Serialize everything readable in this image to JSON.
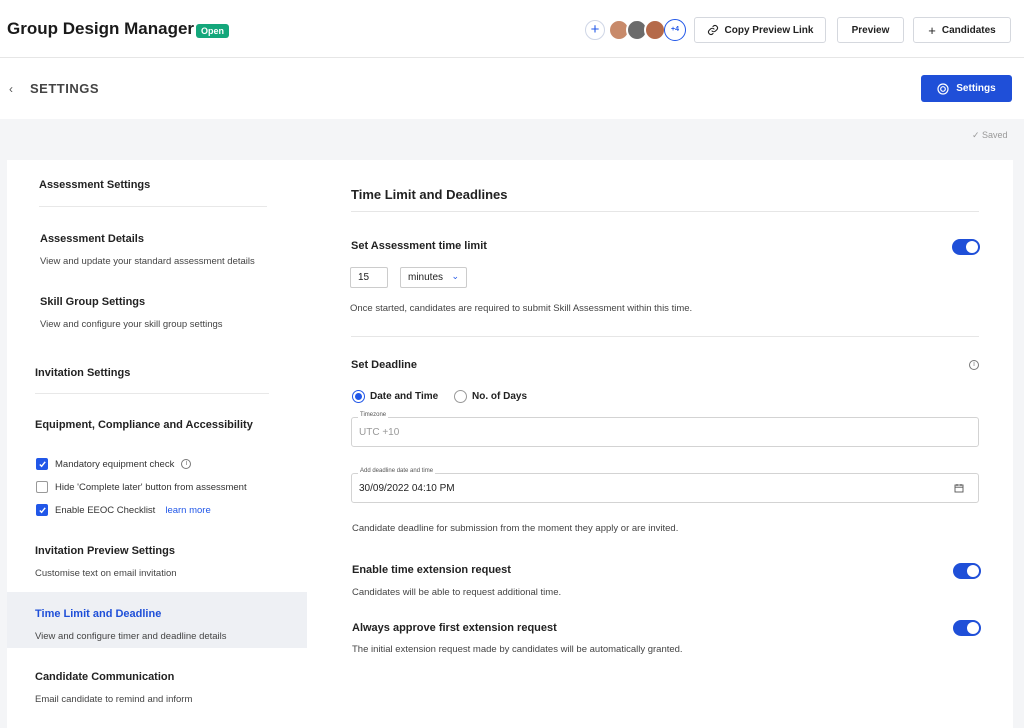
{
  "header": {
    "title": "Group Design Manager",
    "status": "Open",
    "add_collaborator": "+",
    "collaborators_more": "+4",
    "copy_preview_link": "Copy Preview Link",
    "preview": "Preview",
    "candidates": "Candidates",
    "candidates_prefix": "+"
  },
  "subheader": {
    "back": "‹",
    "title": "SETTINGS",
    "settings_button": "Settings",
    "saved": "✓ Saved"
  },
  "sidebar": {
    "assessment_settings": "Assessment Settings",
    "assessment_details": {
      "title": "Assessment Details",
      "desc": "View and update your standard assessment details"
    },
    "skill_group": {
      "title": "Skill Group Settings",
      "desc": "View and configure your skill group settings"
    },
    "invitation_settings": "Invitation Settings",
    "equipment": "Equipment, Compliance and Accessibility",
    "checkboxes": [
      {
        "label": "Mandatory equipment check",
        "checked": true
      },
      {
        "label": "Hide 'Complete later' button from assessment",
        "checked": false
      },
      {
        "label": "Enable EEOC Checklist",
        "checked": true
      }
    ],
    "learn_more": "learn more",
    "invitation_preview": {
      "title": "Invitation Preview Settings",
      "desc": "Customise text on email invitation"
    },
    "time_limit": {
      "title": "Time Limit and Deadline",
      "desc": "View and configure timer and deadline details"
    },
    "candidate_comm": {
      "title": "Candidate Communication",
      "desc": "Email candidate to remind and inform"
    }
  },
  "main": {
    "title": "Time Limit and Deadlines",
    "time_limit": {
      "label": "Set Assessment time limit",
      "enabled": true,
      "value": "15",
      "unit": "minutes",
      "help": "Once started, candidates are required to submit Skill Assessment within this time."
    },
    "deadline": {
      "label": "Set Deadline",
      "options": [
        "Date and Time",
        "No. of Days"
      ],
      "selected": "Date and Time",
      "timezone_label": "Timezone",
      "timezone_value": "UTC +10",
      "date_label": "Add deadline date and time",
      "date_value": "30/09/2022 04:10 PM",
      "help": "Candidate deadline for submission from the moment they apply or are invited."
    },
    "extension": {
      "label": "Enable time extension request",
      "desc": "Candidates will be able to request additional time.",
      "enabled": true
    },
    "auto_approve": {
      "label": "Always approve first extension request",
      "desc": "The initial extension request made by candidates will be automatically granted.",
      "enabled": true
    }
  },
  "colors": {
    "accent": "#1f4fd8",
    "badge": "#14a77b"
  }
}
